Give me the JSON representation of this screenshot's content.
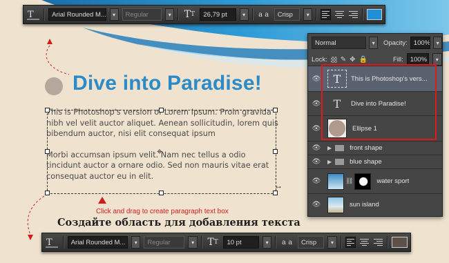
{
  "top_toolbar": {
    "tool_icon": "text-tool-icon",
    "font_family": "Arial Rounded M...",
    "font_style": "Regular",
    "size_icon": "font-size-icon",
    "font_size": "26,79 pt",
    "aa_icon": "anti-alias-icon",
    "aa_icon_label": "a a",
    "anti_alias": "Crisp",
    "color": "#1f8fd8"
  },
  "bottom_toolbar": {
    "tool_icon": "text-tool-icon",
    "font_family": "Arial Rounded M...",
    "font_style": "Regular",
    "size_icon": "font-size-icon",
    "font_size": "10 pt",
    "aa_icon": "anti-alias-icon",
    "aa_icon_label": "a a",
    "anti_alias": "Crisp",
    "color": "#5c5048"
  },
  "canvas": {
    "title": "Dive into Paradise!",
    "paragraph1": "This is Photoshop's version of Lorem Ipsum. Proin gravida nibh vel velit auctor aliquet. Aenean sollicitudin, lorem quis bibendum auctor, nisi elit consequat ipsum",
    "paragraph2": "Morbi accumsan ipsum velit. Nam nec tellus a odio tincidunt auctor a ornare odio. Sed non  mauris vitae erat consequat auctor eu in elit.",
    "tip": "Click and drag to create paragraph text box",
    "russian_caption": "Создайте область для добавления текста"
  },
  "layers_panel": {
    "blend_mode": "Normal",
    "opacity_label": "Opacity:",
    "opacity": "100%",
    "lock_label": "Lock:",
    "fill_label": "Fill:",
    "fill": "100%",
    "layers": [
      {
        "name": "This is Photoshop's vers...",
        "kind": "text",
        "selected": true
      },
      {
        "name": "Dive into Paradise!",
        "kind": "text",
        "selected": false
      },
      {
        "name": "Ellipse 1",
        "kind": "shape",
        "selected": false
      },
      {
        "name": "front shape",
        "kind": "group",
        "selected": false
      },
      {
        "name": "blue shape",
        "kind": "group",
        "selected": false
      },
      {
        "name": "water sport",
        "kind": "image-mask",
        "selected": false
      },
      {
        "name": "sun island",
        "kind": "image",
        "selected": false
      }
    ]
  },
  "colors": {
    "title_blue": "#2b8ac8",
    "tip_red": "#d01c1c",
    "highlight_red": "#e0191d"
  }
}
